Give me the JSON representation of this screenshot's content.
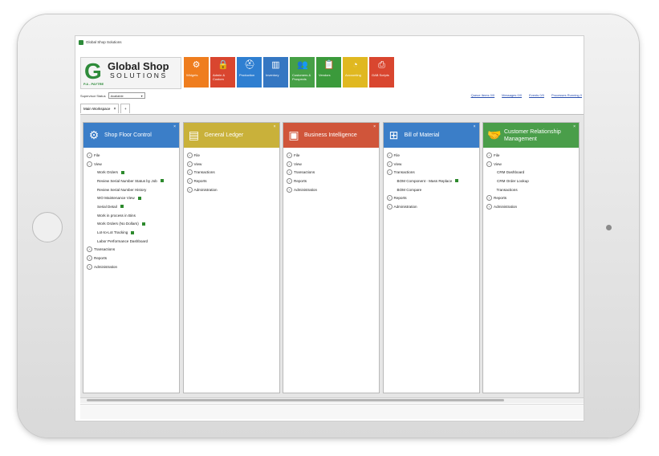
{
  "window": {
    "title": "Global Shop Solutions"
  },
  "logo": {
    "line1": "Global Shop",
    "line2": "SOLUTIONS",
    "sub": "P.A - PAYTRE"
  },
  "ribbon": [
    {
      "label": "Widgets",
      "icon": "gear-icon",
      "glyph": "⚙",
      "color": "#ef7d1e"
    },
    {
      "label": "Admin & Custom",
      "icon": "lock-icon",
      "glyph": "🔒",
      "color": "#d9462f"
    },
    {
      "label": "Production",
      "icon": "hardhat-icon",
      "glyph": "⛑",
      "color": "#2f7fd1"
    },
    {
      "label": "Inventory",
      "icon": "barcode-icon",
      "glyph": "▥",
      "color": "#3577c2"
    },
    {
      "label": "Customers & Prospects",
      "icon": "people-icon",
      "glyph": "👥",
      "color": "#46a046"
    },
    {
      "label": "Vendors",
      "icon": "clipboard-icon",
      "glyph": "📋",
      "color": "#3b9a3b"
    },
    {
      "label": "Accounting",
      "icon": "pie-chart-icon",
      "glyph": "◔",
      "color": "#e0b820"
    },
    {
      "label": "GAB Scripts",
      "icon": "script-icon",
      "glyph": "⎙",
      "color": "#d9462f"
    }
  ],
  "status": {
    "label": "Supervisor Status",
    "value": "Available"
  },
  "links": [
    "Queue Items 0/0",
    "Messages 0/0",
    "Events 0/0",
    "Processes Running 0"
  ],
  "tabs": {
    "main": "Main Workspace",
    "add": "+"
  },
  "panels": [
    {
      "title": "Shop Floor Control",
      "color": "#3b7ec8",
      "icon": "gears-icon",
      "glyph": "⚙",
      "items": [
        {
          "text": "File",
          "level": 0,
          "exp": "+"
        },
        {
          "text": "View",
          "level": 0,
          "exp": "−"
        },
        {
          "text": "Work Orders",
          "level": 1,
          "flag": true
        },
        {
          "text": "Review Serial Number Status by Job",
          "level": 1,
          "flag": true
        },
        {
          "text": "Review Serial Number History",
          "level": 1
        },
        {
          "text": "WO Maintenance View",
          "level": 1,
          "flag": true
        },
        {
          "text": "Serial Detail",
          "level": 1,
          "flag": true
        },
        {
          "text": "Work in process in Bins",
          "level": 1
        },
        {
          "text": "Work Orders (No Dollars)",
          "level": 1,
          "flag": true
        },
        {
          "text": "Lot-to-Lot Tracking",
          "level": 1,
          "flag": true
        },
        {
          "text": "Labor Performance Dashboard",
          "level": 1
        },
        {
          "text": "Transactions",
          "level": 0,
          "exp": "+"
        },
        {
          "text": "Reports",
          "level": 0,
          "exp": "+"
        },
        {
          "text": "Administration",
          "level": 0,
          "exp": "+"
        }
      ]
    },
    {
      "title": "General Ledger",
      "color": "#c9b13a",
      "icon": "ledger-book-icon",
      "glyph": "▤",
      "items": [
        {
          "text": "File",
          "level": 0,
          "exp": "+"
        },
        {
          "text": "View",
          "level": 0,
          "exp": "+"
        },
        {
          "text": "Transactions",
          "level": 0,
          "exp": "+"
        },
        {
          "text": "Reports",
          "level": 0,
          "exp": "+"
        },
        {
          "text": "Administration",
          "level": 0,
          "exp": "+"
        }
      ]
    },
    {
      "title": "Business Intelligence",
      "color": "#d0553a",
      "icon": "chart-board-icon",
      "glyph": "▣",
      "items": [
        {
          "text": "File",
          "level": 0,
          "exp": "+"
        },
        {
          "text": "View",
          "level": 0,
          "exp": "+"
        },
        {
          "text": "Transactions",
          "level": 0,
          "exp": "+"
        },
        {
          "text": "Reports",
          "level": 0,
          "exp": "+"
        },
        {
          "text": "Administration",
          "level": 0,
          "exp": "+"
        }
      ]
    },
    {
      "title": "Bill of Material",
      "color": "#3b7ec8",
      "icon": "hierarchy-icon",
      "glyph": "⊞",
      "items": [
        {
          "text": "File",
          "level": 0,
          "exp": "+"
        },
        {
          "text": "View",
          "level": 0,
          "exp": "+"
        },
        {
          "text": "Transactions",
          "level": 0,
          "exp": "−"
        },
        {
          "text": "BOM Component - Mass Replace",
          "level": 1,
          "flag": true
        },
        {
          "text": "BOM Compare",
          "level": 1
        },
        {
          "text": "Reports",
          "level": 0,
          "exp": "+"
        },
        {
          "text": "Administration",
          "level": 0,
          "exp": "+"
        }
      ]
    },
    {
      "title": "Customer Relationship Management",
      "color": "#4a9e4a",
      "icon": "handshake-icon",
      "glyph": "🤝",
      "items": [
        {
          "text": "File",
          "level": 0,
          "exp": "+"
        },
        {
          "text": "View",
          "level": 0,
          "exp": "−"
        },
        {
          "text": "CRM Dashboard",
          "level": 1
        },
        {
          "text": "CRM Order Lookup",
          "level": 1
        },
        {
          "text": "Transactions",
          "level": 2
        },
        {
          "text": "Reports",
          "level": 0,
          "exp": "+"
        },
        {
          "text": "Administration",
          "level": 0,
          "exp": "+"
        }
      ]
    }
  ]
}
